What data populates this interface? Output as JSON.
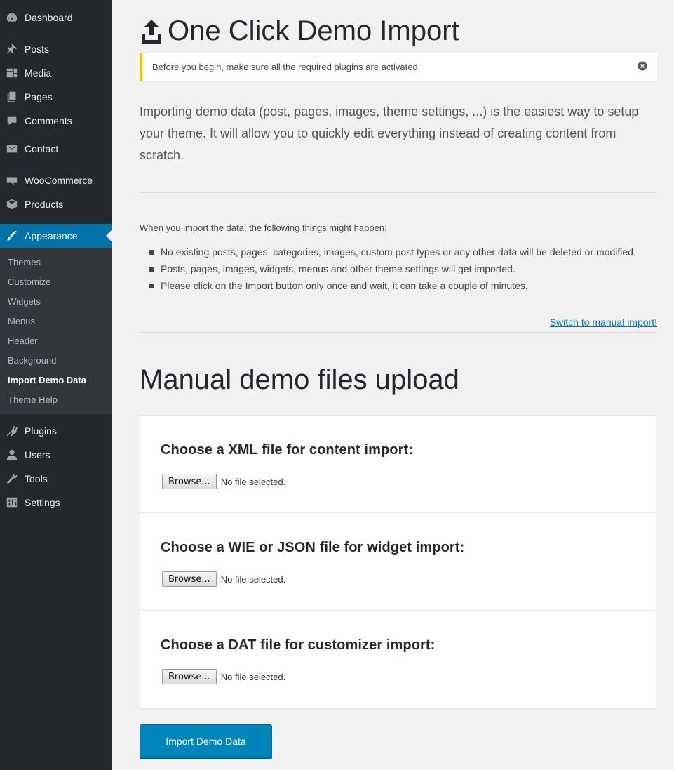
{
  "sidebar": {
    "menu": {
      "dashboard": "Dashboard",
      "posts": "Posts",
      "media": "Media",
      "pages": "Pages",
      "comments": "Comments",
      "contact": "Contact",
      "woocommerce": "WooCommerce",
      "products": "Products",
      "appearance": "Appearance",
      "plugins": "Plugins",
      "users": "Users",
      "tools": "Tools",
      "settings": "Settings"
    },
    "submenu": [
      "Themes",
      "Customize",
      "Widgets",
      "Menus",
      "Header",
      "Background",
      "Import Demo Data",
      "Theme Help"
    ],
    "current_submenu": "Import Demo Data",
    "colors": {
      "bg": "#23282d",
      "submenu_bg": "#32373c",
      "active": "#0073aa"
    }
  },
  "main": {
    "title": "One Click Demo Import",
    "notice": "Before you begin, make sure all the required plugins are activated.",
    "intro": "Importing demo data (post, pages, images, theme settings, ...) is the easiest way to setup your theme. It will allow you to quickly edit everything instead of creating content from scratch.",
    "info_lead": "When you import the data, the following things might happen:",
    "info_items": [
      "No existing posts, pages, categories, images, custom post types or any other data will be deleted or modified.",
      "Posts, pages, images, widgets, menus and other theme settings will get imported.",
      "Please click on the Import button only once and wait, it can take a couple of minutes."
    ],
    "manual_link": "Switch to manual import!",
    "manual_heading": "Manual demo files upload",
    "uploads": [
      {
        "label": "Choose a XML file for content import:",
        "button": "Browse...",
        "status": "No file selected."
      },
      {
        "label": "Choose a WIE or JSON file for widget import:",
        "button": "Browse...",
        "status": "No file selected."
      },
      {
        "label": "Choose a DAT file for customizer import:",
        "button": "Browse...",
        "status": "No file selected."
      }
    ],
    "import_button": "Import Demo Data",
    "colors": {
      "notice_border": "#ffb900",
      "button": "#0085ba",
      "link": "#0073aa"
    }
  }
}
